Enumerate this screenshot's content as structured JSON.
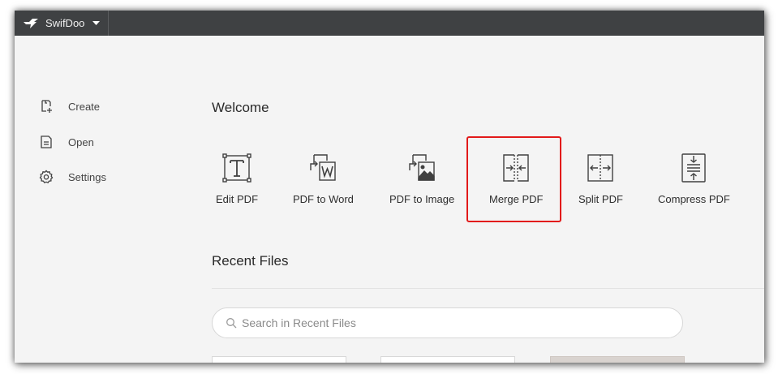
{
  "titlebar": {
    "app_name": "SwifDoo",
    "logo_icon": "swift-bird-logo",
    "menu_icon": "caret-down-icon"
  },
  "sidebar": {
    "items": [
      {
        "label": "Create",
        "icon": "create-file-icon"
      },
      {
        "label": "Open",
        "icon": "open-file-icon"
      },
      {
        "label": "Settings",
        "icon": "gear-icon"
      }
    ]
  },
  "main": {
    "welcome_title": "Welcome",
    "tools": [
      {
        "label": "Edit PDF",
        "icon": "text-frame-icon"
      },
      {
        "label": "PDF to Word",
        "icon": "pdf-to-word-icon"
      },
      {
        "label": "PDF to Image",
        "icon": "pdf-to-image-icon"
      },
      {
        "label": "Merge PDF",
        "icon": "merge-pdf-icon",
        "highlighted": true
      },
      {
        "label": "Split PDF",
        "icon": "split-pdf-icon"
      },
      {
        "label": "Compress PDF",
        "icon": "compress-pdf-icon"
      }
    ],
    "recent_title": "Recent Files",
    "search": {
      "placeholder": "Search in Recent Files",
      "value": ""
    }
  },
  "colors": {
    "titlebar_bg": "#3f4143",
    "window_bg": "#f4f4f4",
    "highlight_border": "#e21a1a",
    "icon_stroke": "#404040"
  }
}
